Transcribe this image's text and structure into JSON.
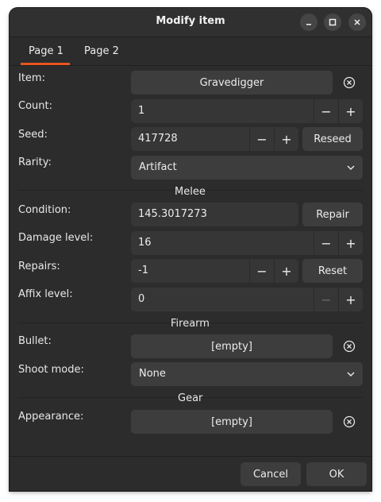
{
  "window": {
    "title": "Modify item"
  },
  "tabs": [
    {
      "label": "Page 1"
    },
    {
      "label": "Page 2"
    }
  ],
  "fields": {
    "item": {
      "label": "Item:",
      "value": "Gravedigger"
    },
    "count": {
      "label": "Count:",
      "value": "1"
    },
    "seed": {
      "label": "Seed:",
      "value": "417728",
      "button": "Reseed"
    },
    "rarity": {
      "label": "Rarity:",
      "value": "Artifact"
    },
    "condition": {
      "label": "Condition:",
      "value": "145.3017273",
      "button": "Repair"
    },
    "damage_level": {
      "label": "Damage level:",
      "value": "16"
    },
    "repairs": {
      "label": "Repairs:",
      "value": "-1",
      "button": "Reset"
    },
    "affix_level": {
      "label": "Affix level:",
      "value": "0"
    },
    "bullet": {
      "label": "Bullet:",
      "value": "[empty]"
    },
    "shoot_mode": {
      "label": "Shoot mode:",
      "value": "None"
    },
    "appearance": {
      "label": "Appearance:",
      "value": "[empty]"
    }
  },
  "sections": {
    "melee": "Melee",
    "firearm": "Firearm",
    "gear": "Gear"
  },
  "symbols": {
    "minus": "−",
    "plus": "+"
  },
  "footer": {
    "cancel": "Cancel",
    "ok": "OK"
  }
}
